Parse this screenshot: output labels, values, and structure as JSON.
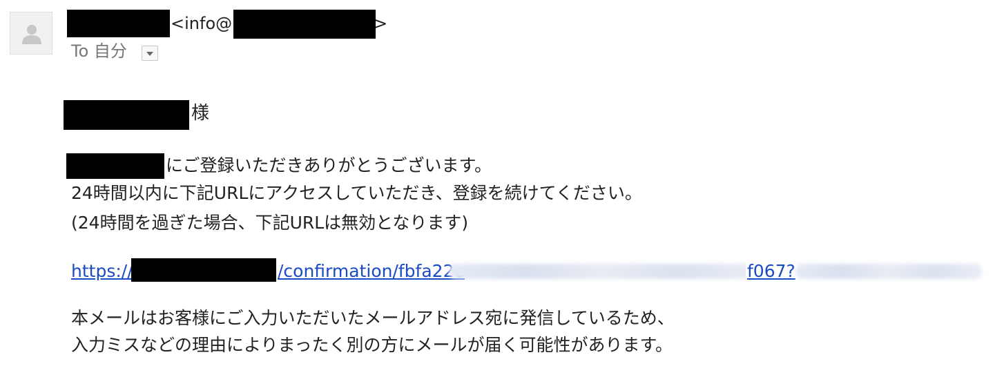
{
  "header": {
    "sender_email_prefix": "<info@",
    "sender_email_suffix": ">",
    "to_label": "To 自分"
  },
  "message": {
    "salutation_suffix": "様",
    "line1_suffix": "にご登録いただきありがとうございます。",
    "line2": "24時間以内に下記URLにアクセスしていただき、登録を続けてください。",
    "line3": "(24時間を過ぎた場合、下記URLは無効となります)",
    "link_prefix": "https://",
    "link_middle": "/confirmation/fbfa22e",
    "link_suffix": "f067?",
    "notice_line1": "本メールはお客様にご入力いただいたメールアドレス宛に発信しているため、",
    "notice_line2": "入力ミスなどの理由によりまったく別の方にメールが届く可能性があります。"
  },
  "colors": {
    "link": "#1a4bc4",
    "redaction": "#000000",
    "muted_text": "#777777"
  },
  "icons": {
    "avatar": "person-silhouette-icon",
    "dropdown": "chevron-down-icon"
  }
}
